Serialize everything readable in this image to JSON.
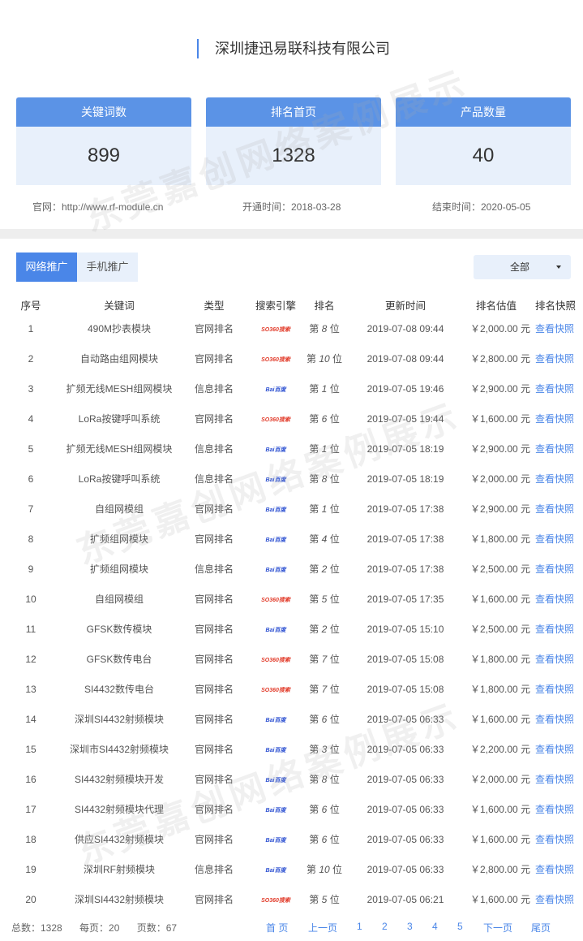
{
  "company": "深圳捷迅易联科技有限公司",
  "stats": [
    {
      "label": "关键词数",
      "value": "899"
    },
    {
      "label": "排名首页",
      "value": "1328"
    },
    {
      "label": "产品数量",
      "value": "40"
    }
  ],
  "meta": {
    "website": "官网：http://www.rf-module.cn",
    "start": "开通时间：2018-03-28",
    "end": "结束时间：2020-05-05"
  },
  "tabs": [
    "网络推广",
    "手机推广"
  ],
  "filter": "全部",
  "columns": [
    "序号",
    "关键词",
    "类型",
    "搜索引擎",
    "排名",
    "更新时间",
    "排名估值",
    "排名快照"
  ],
  "engines": {
    "so": "SO360搜索",
    "baidu": "Bai百度"
  },
  "rows": [
    {
      "no": "1",
      "kw": "490M抄表模块",
      "type": "官网排名",
      "engine": "so",
      "rank_pre": "第",
      "rank": "8",
      "rank_post": "位",
      "time": "2019-07-08 09:44",
      "value": "￥2,000.00 元",
      "snap": "查看快照"
    },
    {
      "no": "2",
      "kw": "自动路由组网模块",
      "type": "官网排名",
      "engine": "so",
      "rank_pre": "第",
      "rank": "10",
      "rank_post": "位",
      "time": "2019-07-08 09:44",
      "value": "￥2,800.00 元",
      "snap": "查看快照"
    },
    {
      "no": "3",
      "kw": "扩频无线MESH组网模块",
      "type": "信息排名",
      "engine": "baidu",
      "rank_pre": "第",
      "rank": "1",
      "rank_post": "位",
      "time": "2019-07-05 19:46",
      "value": "￥2,900.00 元",
      "snap": "查看快照"
    },
    {
      "no": "4",
      "kw": "LoRa按键呼叫系统",
      "type": "官网排名",
      "engine": "so",
      "rank_pre": "第",
      "rank": "6",
      "rank_post": "位",
      "time": "2019-07-05 19:44",
      "value": "￥1,600.00 元",
      "snap": "查看快照"
    },
    {
      "no": "5",
      "kw": "扩频无线MESH组网模块",
      "type": "信息排名",
      "engine": "baidu",
      "rank_pre": "第",
      "rank": "1",
      "rank_post": "位",
      "time": "2019-07-05 18:19",
      "value": "￥2,900.00 元",
      "snap": "查看快照"
    },
    {
      "no": "6",
      "kw": "LoRa按键呼叫系统",
      "type": "信息排名",
      "engine": "baidu",
      "rank_pre": "第",
      "rank": "8",
      "rank_post": "位",
      "time": "2019-07-05 18:19",
      "value": "￥2,000.00 元",
      "snap": "查看快照"
    },
    {
      "no": "7",
      "kw": "自组网模组",
      "type": "官网排名",
      "engine": "baidu",
      "rank_pre": "第",
      "rank": "1",
      "rank_post": "位",
      "time": "2019-07-05 17:38",
      "value": "￥2,900.00 元",
      "snap": "查看快照"
    },
    {
      "no": "8",
      "kw": "扩频组网模块",
      "type": "官网排名",
      "engine": "baidu",
      "rank_pre": "第",
      "rank": "4",
      "rank_post": "位",
      "time": "2019-07-05 17:38",
      "value": "￥1,800.00 元",
      "snap": "查看快照"
    },
    {
      "no": "9",
      "kw": "扩频组网模块",
      "type": "信息排名",
      "engine": "baidu",
      "rank_pre": "第",
      "rank": "2",
      "rank_post": "位",
      "time": "2019-07-05 17:38",
      "value": "￥2,500.00 元",
      "snap": "查看快照"
    },
    {
      "no": "10",
      "kw": "自组网模组",
      "type": "官网排名",
      "engine": "so",
      "rank_pre": "第",
      "rank": "5",
      "rank_post": "位",
      "time": "2019-07-05 17:35",
      "value": "￥1,600.00 元",
      "snap": "查看快照"
    },
    {
      "no": "11",
      "kw": "GFSK数传模块",
      "type": "官网排名",
      "engine": "baidu",
      "rank_pre": "第",
      "rank": "2",
      "rank_post": "位",
      "time": "2019-07-05 15:10",
      "value": "￥2,500.00 元",
      "snap": "查看快照"
    },
    {
      "no": "12",
      "kw": "GFSK数传电台",
      "type": "官网排名",
      "engine": "so",
      "rank_pre": "第",
      "rank": "7",
      "rank_post": "位",
      "time": "2019-07-05 15:08",
      "value": "￥1,800.00 元",
      "snap": "查看快照"
    },
    {
      "no": "13",
      "kw": "SI4432数传电台",
      "type": "官网排名",
      "engine": "so",
      "rank_pre": "第",
      "rank": "7",
      "rank_post": "位",
      "time": "2019-07-05 15:08",
      "value": "￥1,800.00 元",
      "snap": "查看快照"
    },
    {
      "no": "14",
      "kw": "深圳SI4432射频模块",
      "type": "官网排名",
      "engine": "baidu",
      "rank_pre": "第",
      "rank": "6",
      "rank_post": "位",
      "time": "2019-07-05 06:33",
      "value": "￥1,600.00 元",
      "snap": "查看快照"
    },
    {
      "no": "15",
      "kw": "深圳市SI4432射频模块",
      "type": "官网排名",
      "engine": "baidu",
      "rank_pre": "第",
      "rank": "3",
      "rank_post": "位",
      "time": "2019-07-05 06:33",
      "value": "￥2,200.00 元",
      "snap": "查看快照"
    },
    {
      "no": "16",
      "kw": "SI4432射频模块开发",
      "type": "官网排名",
      "engine": "baidu",
      "rank_pre": "第",
      "rank": "8",
      "rank_post": "位",
      "time": "2019-07-05 06:33",
      "value": "￥2,000.00 元",
      "snap": "查看快照"
    },
    {
      "no": "17",
      "kw": "SI4432射频模块代理",
      "type": "官网排名",
      "engine": "baidu",
      "rank_pre": "第",
      "rank": "6",
      "rank_post": "位",
      "time": "2019-07-05 06:33",
      "value": "￥1,600.00 元",
      "snap": "查看快照"
    },
    {
      "no": "18",
      "kw": "供应SI4432射频模块",
      "type": "官网排名",
      "engine": "baidu",
      "rank_pre": "第",
      "rank": "6",
      "rank_post": "位",
      "time": "2019-07-05 06:33",
      "value": "￥1,600.00 元",
      "snap": "查看快照"
    },
    {
      "no": "19",
      "kw": "深圳RF射频模块",
      "type": "信息排名",
      "engine": "baidu",
      "rank_pre": "第",
      "rank": "10",
      "rank_post": "位",
      "time": "2019-07-05 06:33",
      "value": "￥2,800.00 元",
      "snap": "查看快照"
    },
    {
      "no": "20",
      "kw": "深圳SI4432射频模块",
      "type": "官网排名",
      "engine": "so",
      "rank_pre": "第",
      "rank": "5",
      "rank_post": "位",
      "time": "2019-07-05 06:21",
      "value": "￥1,600.00 元",
      "snap": "查看快照"
    }
  ],
  "footer": {
    "total": "总数：1328",
    "per_page": "每页：20",
    "pages": "页数：67",
    "first": "首 页",
    "prev": "上一页",
    "page_numbers": [
      "1",
      "2",
      "3",
      "4",
      "5"
    ],
    "next": "下一页",
    "last": "尾页"
  },
  "watermark": "东莞嘉创网络案例展示",
  "colors": {
    "accent": "#4a86e8",
    "card_bg": "#e8f0fb",
    "card_head": "#5b93e6"
  }
}
